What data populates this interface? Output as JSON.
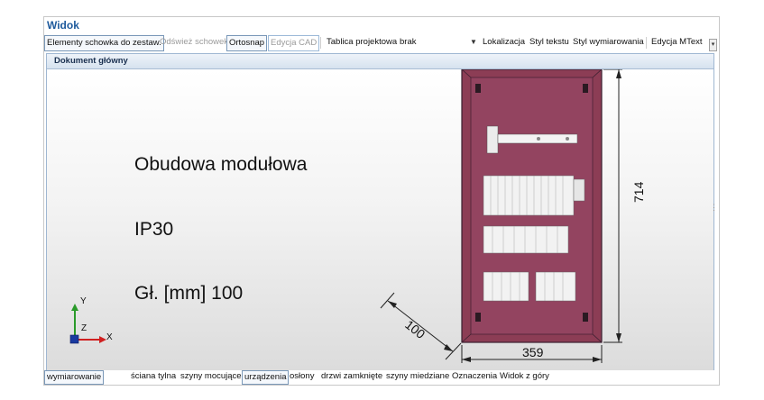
{
  "window": {
    "title": "Widok"
  },
  "toolbar": {
    "items": [
      {
        "label": "Elementy schowka do zestaw.",
        "enabled": true
      },
      {
        "label": "Odśwież schowek",
        "enabled": false
      },
      {
        "label": "Ortosnap",
        "enabled": true
      },
      {
        "label": "Edycja CAD",
        "enabled": false
      }
    ],
    "tablica_label": "Tablica projektowa",
    "tablica_value": "brak",
    "right_items": [
      "Lokalizacja",
      "Styl tekstu",
      "Styl wymiarowania",
      "Edycja MText"
    ]
  },
  "document": {
    "title": "Dokument główny",
    "texts": {
      "line1": "Obudowa modułowa",
      "line2": "IP30",
      "line3": "Gł. [mm] 100"
    },
    "dimensions": {
      "width": "359",
      "height": "714",
      "depth": "100"
    },
    "axes": {
      "x": "X",
      "y": "Y",
      "z": "Z"
    },
    "colors": {
      "enclosure": "#8c3d55",
      "frame_border": "#3a2030",
      "dimension_line": "#222222"
    }
  },
  "tabs": [
    {
      "label": "wymiarowanie",
      "active": true
    },
    {
      "label": "ściana tylna",
      "active": false
    },
    {
      "label": "szyny mocujące",
      "active": false
    },
    {
      "label": "urządzenia",
      "active": true
    },
    {
      "label": "osłony",
      "active": false
    },
    {
      "label": "drzwi zamknięte",
      "active": false
    },
    {
      "label": "szyny miedziane",
      "active": false
    },
    {
      "label": "Oznaczenia",
      "active": false
    },
    {
      "label": "Widok z góry",
      "active": false
    }
  ]
}
